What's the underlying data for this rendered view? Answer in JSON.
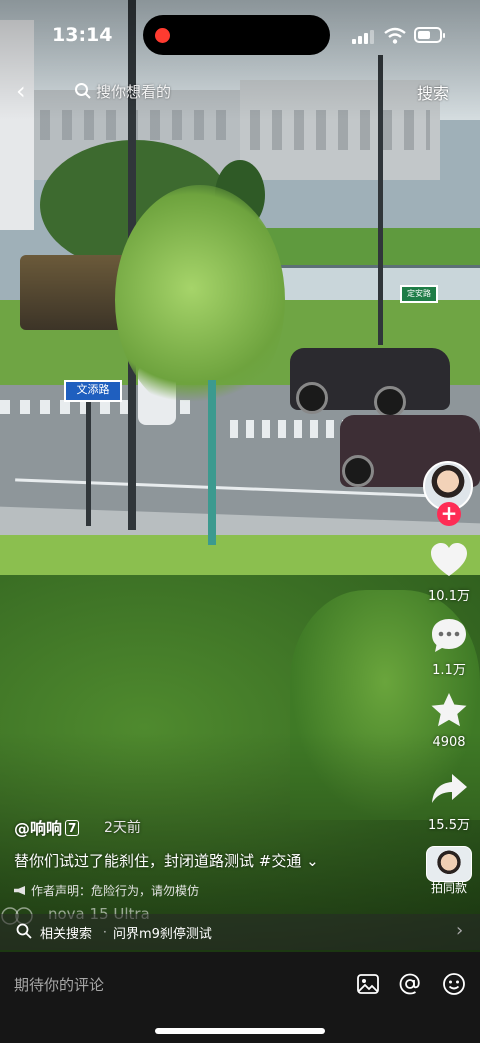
{
  "status_bar": {
    "time": "13:14"
  },
  "search": {
    "placeholder": "搜你想看的",
    "button": "搜索"
  },
  "scene": {
    "sign_road": "文添路",
    "sign_green": "定安路"
  },
  "rail": {
    "likes": "10.1万",
    "comments": "1.1万",
    "favorites": "4908",
    "shares": "15.5万",
    "same_style": "拍同款"
  },
  "post": {
    "author": "@响响",
    "author_badge": "7",
    "time": "2天前",
    "description": "替你们试过了能刹住，封闭道路测试 #交通",
    "notice": "作者声明：危险行为，请勿模仿",
    "watermark": "nova 15 Ultra"
  },
  "related": {
    "label": "相关搜索",
    "separator": "·",
    "query": "问界m9刹停测试"
  },
  "comment": {
    "placeholder": "期待你的评论"
  },
  "colors": {
    "accent": "#fe2c55",
    "comment_bar": "#161616"
  }
}
